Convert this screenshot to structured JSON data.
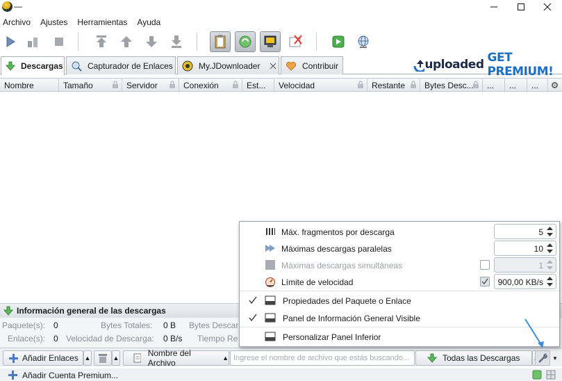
{
  "window": {
    "title": "—"
  },
  "menu": [
    "Archivo",
    "Ajustes",
    "Herramientas",
    "Ayuda"
  ],
  "tabs": [
    {
      "label": "Descargas",
      "icon": "download-arrow-icon"
    },
    {
      "label": "Capturador de Enlaces",
      "icon": "link-grabber-icon"
    },
    {
      "label": "My.JDownloader",
      "icon": "myjdownloader-icon"
    },
    {
      "label": "Contribuir",
      "icon": "heart-icon"
    }
  ],
  "premium_banner": {
    "brand": "uploaded",
    "cta": "GET PREMIUM!"
  },
  "columns": [
    "Nombre",
    "Tamaño",
    "Servidor",
    "Conexión",
    "Est...",
    "Velocidad",
    "Restante",
    "Bytes Desc...",
    "...",
    "...",
    "..."
  ],
  "info_panel": {
    "title": "Información general de las descargas",
    "rows": [
      {
        "label1": "Paquete(s):",
        "value1": "0",
        "label2": "Bytes Totales:",
        "value2": "0 B",
        "label3": "Bytes Descar"
      },
      {
        "label1": "Enlace(s):",
        "value1": "0",
        "label2": "Velocidad de Descarga:",
        "value2": "0 B/s",
        "label3": "Tiempo Re"
      }
    ]
  },
  "bottom_bar": {
    "add_links": "Añadir Enlaces",
    "sort_by": "Nombre del Archivo",
    "search_placeholder": "Ingrese el nombre de archivo que estás buscando...",
    "filter": "Todas las Descargas"
  },
  "status_bar": {
    "add_premium": "Añadir Cuenta Premium..."
  },
  "popup": {
    "max_chunks": {
      "label": "Máx. fragmentos por descarga",
      "value": "5"
    },
    "max_parallel": {
      "label": "Máximas descargas paralelas",
      "value": "10"
    },
    "max_simultaneous": {
      "label": "Máximas descargas simultáneas",
      "value": "1",
      "enabled": false
    },
    "speed_limit": {
      "label": "Límite de velocidad",
      "value": "900,00 KB/s",
      "checked": true
    },
    "package_props": {
      "label": "Propiedades del Paquete o Enlace",
      "checked": true
    },
    "info_panel_visible": {
      "label": "Panel de Información General Visible",
      "checked": true
    },
    "customize": {
      "label": "Personalizar Panel Inferior"
    }
  },
  "colors": {
    "accent_green": "#3fa535",
    "accent_blue": "#4a90d9",
    "annotation_arrow": "#3b8fd6"
  }
}
